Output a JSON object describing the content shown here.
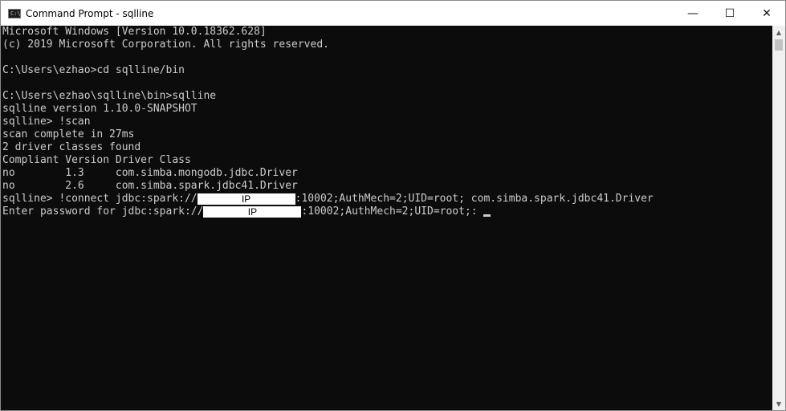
{
  "window": {
    "title": "Command Prompt - sqlline",
    "icon_label": "C:\\",
    "minimize": "—",
    "maximize": "☐",
    "close": "✕"
  },
  "console": {
    "lines": [
      "Microsoft Windows [Version 10.0.18362.628]",
      "(c) 2019 Microsoft Corporation. All rights reserved.",
      "",
      "C:\\Users\\ezhao>cd sqlline/bin",
      "",
      "C:\\Users\\ezhao\\sqlline\\bin>sqlline",
      "sqlline version 1.10.0-SNAPSHOT",
      "sqlline> !scan",
      "scan complete in 27ms",
      "2 driver classes found",
      "Compliant Version Driver Class",
      "no        1.3     com.simba.mongodb.jdbc.Driver",
      "no        2.6     com.simba.spark.jdbc41.Driver"
    ],
    "connect_prefix": "sqlline> !connect jdbc:spark://",
    "connect_redacted": "IP",
    "connect_suffix": ":10002;AuthMech=2;UID=root; com.simba.spark.jdbc41.Driver",
    "password_prefix": "Enter password for jdbc:spark://",
    "password_redacted": "IP",
    "password_suffix": ":10002;AuthMech=2;UID=root;: "
  },
  "scrollbar": {
    "up_arrow": "▲",
    "down_arrow": "▼"
  }
}
